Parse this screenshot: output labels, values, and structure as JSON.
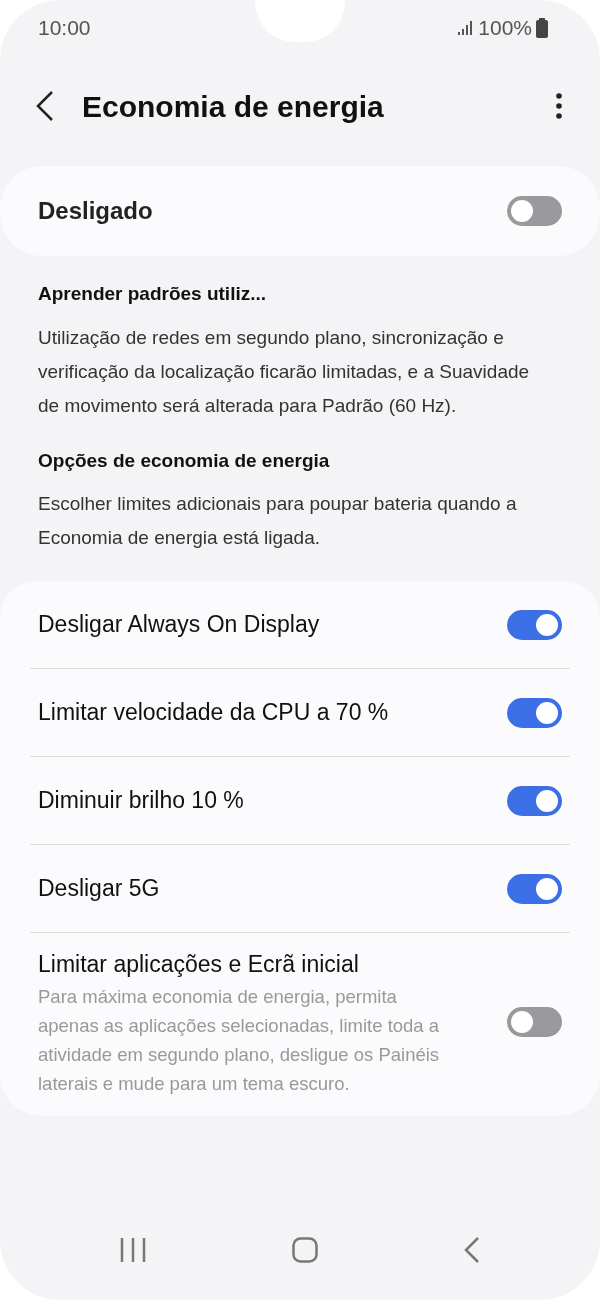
{
  "status_bar": {
    "time": "10:00",
    "battery": "100%"
  },
  "header": {
    "title": "Economia de energia"
  },
  "master": {
    "label": "Desligado",
    "on": false
  },
  "sections": [
    {
      "heading": "Aprender padrões utiliz...",
      "text": "Utilização de redes em segundo plano, sincronização e verificação da localização ficarão limitadas, e a Suavidade de movimento será alterada para Padrão (60 Hz)."
    },
    {
      "heading": "Opções de economia de energia",
      "text": "Escolher limites adicionais para poupar bateria quando a Economia de energia está ligada."
    }
  ],
  "options": [
    {
      "label": "Desligar Always On Display",
      "on": true
    },
    {
      "label": "Limitar velocidade da CPU a 70 %",
      "on": true
    },
    {
      "label": "Diminuir brilho 10 %",
      "on": true
    },
    {
      "label": "Desligar 5G",
      "on": true
    },
    {
      "label": "Limitar aplicações e Ecrã inicial",
      "description": "Para máxima economia de energia, permita apenas as aplicações selecionadas, limite toda a atividade em segundo plano, desligue os Painéis laterais e mude para um tema escuro.",
      "on": false
    }
  ]
}
